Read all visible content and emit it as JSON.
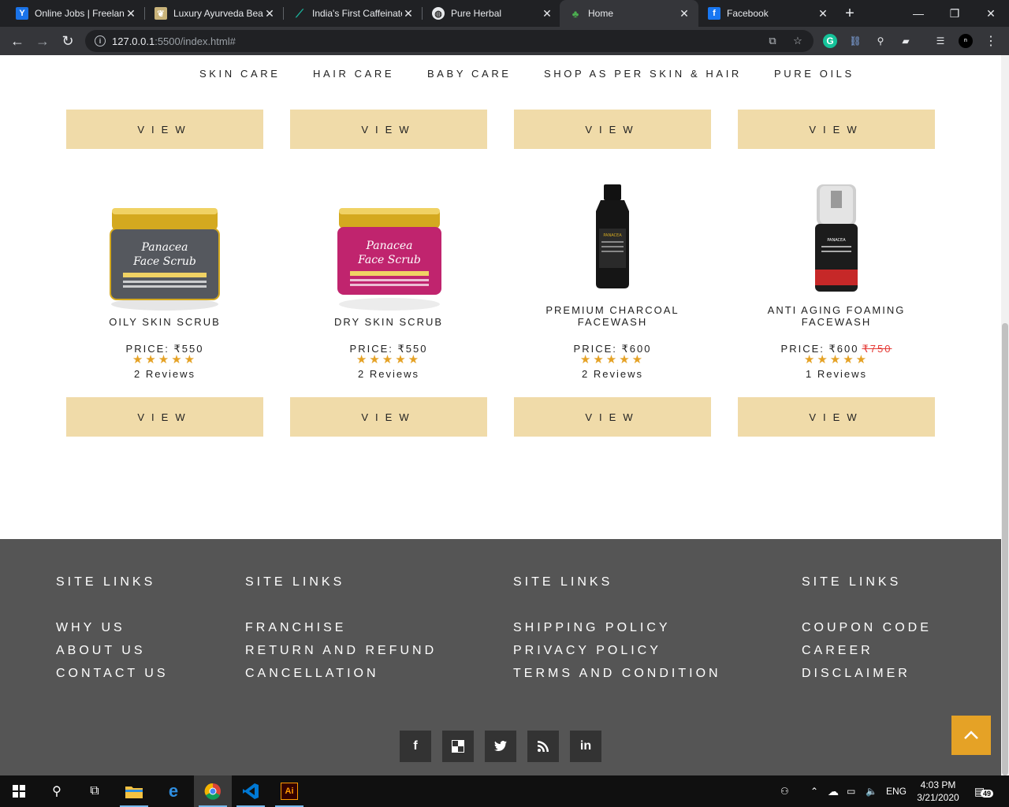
{
  "browser": {
    "tabs": [
      {
        "title": "Online Jobs | Freelance",
        "favicon": "y-icon",
        "color": "#1a73e8"
      },
      {
        "title": "Luxury Ayurveda Beauty",
        "favicon": "leaf-logo-icon",
        "color": "#c9b37a"
      },
      {
        "title": "India's First Caffeinated",
        "favicon": "feather-icon",
        "color": "#1bb39c"
      },
      {
        "title": "Pure Herbal",
        "favicon": "globe-icon",
        "color": "#e8eaed"
      },
      {
        "title": "Home",
        "favicon": "herbal-logo-icon",
        "color": "#4caf50"
      },
      {
        "title": "Facebook",
        "favicon": "facebook-icon",
        "color": "#1877f2"
      }
    ],
    "active_tab": 4,
    "url_host": "127.0.0.1",
    "url_path": ":5500/index.html#"
  },
  "nav": {
    "items": [
      "SKIN CARE",
      "HAIR CARE",
      "BABY CARE",
      "SHOP AS PER SKIN & HAIR",
      "PURE OILS"
    ]
  },
  "view_label": "VIEW",
  "products": [
    {
      "name": "OILY SKIN SCRUB",
      "price": "PRICE: ₹550",
      "old_price": "",
      "rating": 5,
      "stars": "★★★★★",
      "reviews": "2 Reviews",
      "image": "jar-black-icon",
      "jar_color": "#55585e",
      "jar_label": "Panacea Face Scrub"
    },
    {
      "name": "DRY SKIN SCRUB",
      "price": "PRICE: ₹550",
      "old_price": "",
      "rating": 5,
      "stars": "★★★★★",
      "reviews": "2 Reviews",
      "image": "jar-pink-icon",
      "jar_color": "#c0246e",
      "jar_label": "Panacea Face Scrub"
    },
    {
      "name": "PREMIUM CHARCOAL FACEWASH",
      "price": "PRICE: ₹600",
      "old_price": "",
      "rating": 5,
      "stars": "★★★★★",
      "reviews": "2 Reviews",
      "image": "bottle-black-icon",
      "jar_color": "#151515",
      "jar_label": "PANACEA"
    },
    {
      "name": "ANTI AGING FOAMING FACEWASH",
      "price": "PRICE: ₹600",
      "old_price": "₹750",
      "rating": 5,
      "stars": "★★★★★",
      "reviews": "1 Reviews",
      "image": "foam-bottle-icon",
      "jar_color": "#1c1c1c",
      "jar_label": "PANACEA"
    }
  ],
  "footer": {
    "columns": [
      {
        "heading": "SITE LINKS",
        "links": [
          "WHY US",
          "ABOUT US",
          "CONTACT US"
        ]
      },
      {
        "heading": "SITE LINKS",
        "links": [
          "FRANCHISE",
          "RETURN AND REFUND",
          "CANCELLATION"
        ]
      },
      {
        "heading": "SITE LINKS",
        "links": [
          "SHIPPING POLICY",
          "PRIVACY POLICY",
          "TERMS AND CONDITION"
        ]
      },
      {
        "heading": "SITE LINKS",
        "links": [
          "COUPON CODE",
          "CAREER",
          "DISCLAIMER"
        ]
      }
    ],
    "social": [
      {
        "name": "facebook-icon",
        "glyph": "f"
      },
      {
        "name": "delicious-icon",
        "glyph": "▣"
      },
      {
        "name": "twitter-icon",
        "glyph": "🐦"
      },
      {
        "name": "rss-icon",
        "glyph": "◉"
      },
      {
        "name": "linkedin-icon",
        "glyph": "in"
      }
    ],
    "bg_color": "#555555",
    "accent_color": "#e5a226"
  },
  "taskbar": {
    "language": "ENG",
    "time": "4:03 PM",
    "date": "3/21/2020",
    "notifications": "49"
  },
  "colors": {
    "view_button": "#f0dba9",
    "star": "#e5a226",
    "old_price": "#e53935"
  }
}
